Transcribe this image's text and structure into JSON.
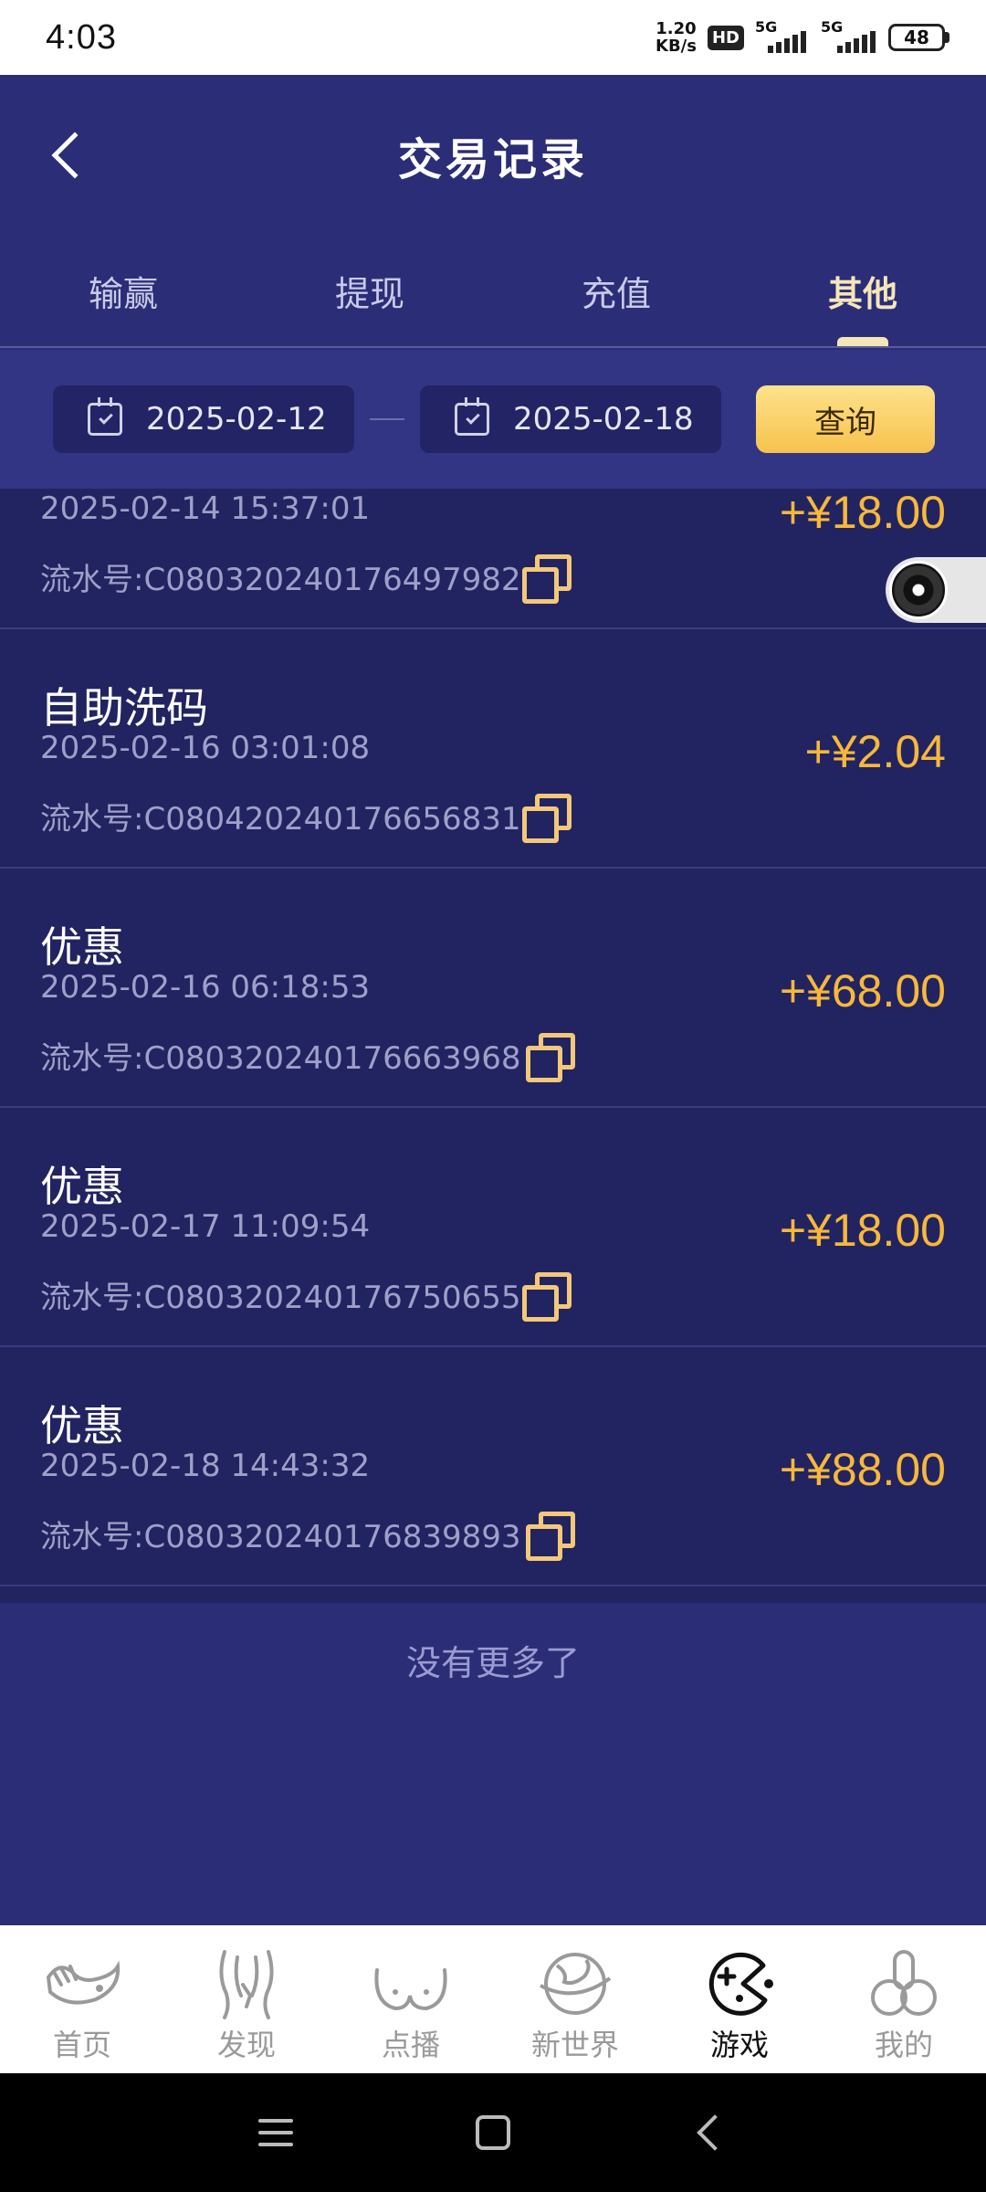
{
  "status_bar": {
    "time": "4:03",
    "net_speed_value": "1.20",
    "net_speed_unit": "KB/s",
    "hd_badge": "HD",
    "signal1_label": "5G",
    "signal2_label": "5G",
    "battery": "48"
  },
  "header": {
    "title": "交易记录"
  },
  "tabs": [
    {
      "label": "输赢",
      "active": false
    },
    {
      "label": "提现",
      "active": false
    },
    {
      "label": "充值",
      "active": false
    },
    {
      "label": "其他",
      "active": true
    }
  ],
  "filter": {
    "start_date": "2025-02-12",
    "end_date": "2025-02-18",
    "query_label": "查询"
  },
  "records": [
    {
      "title": "",
      "time": "2025-02-14 15:37:01",
      "serial": "流水号:C080320240176497982",
      "amount": "+¥18.00"
    },
    {
      "title": "自助洗码",
      "time": "2025-02-16 03:01:08",
      "serial": "流水号:C080420240176656831",
      "amount": "+¥2.04"
    },
    {
      "title": "优惠",
      "time": "2025-02-16 06:18:53",
      "serial": "流水号:C080320240176663968",
      "amount": "+¥68.00"
    },
    {
      "title": "优惠",
      "time": "2025-02-17 11:09:54",
      "serial": "流水号:C080320240176750655",
      "amount": "+¥18.00"
    },
    {
      "title": "优惠",
      "time": "2025-02-18 14:43:32",
      "serial": "流水号:C080320240176839893",
      "amount": "+¥88.00"
    }
  ],
  "list_footer": "没有更多了",
  "bottom_nav": [
    {
      "label": "首页",
      "icon": "home-hand-icon",
      "active": false
    },
    {
      "label": "发现",
      "icon": "discover-figure-icon",
      "active": false
    },
    {
      "label": "点播",
      "icon": "vod-icon",
      "active": false
    },
    {
      "label": "新世界",
      "icon": "new-world-globe-icon",
      "active": false
    },
    {
      "label": "游戏",
      "icon": "game-pacman-icon",
      "active": true
    },
    {
      "label": "我的",
      "icon": "profile-icon",
      "active": false
    }
  ],
  "colors": {
    "background": "#2b2d77",
    "list_background": "#222361",
    "amount": "#f7b83a",
    "active_tab": "#f5e6b8",
    "query_button": "#f7c24d"
  }
}
